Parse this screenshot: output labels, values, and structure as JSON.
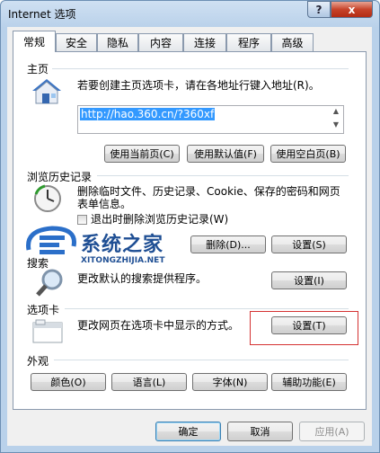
{
  "window": {
    "title": "Internet 选项",
    "help": "?",
    "close": "x"
  },
  "tabs": [
    {
      "label": "常规",
      "active": true
    },
    {
      "label": "安全"
    },
    {
      "label": "隐私"
    },
    {
      "label": "内容"
    },
    {
      "label": "连接"
    },
    {
      "label": "程序"
    },
    {
      "label": "高级"
    }
  ],
  "homepage": {
    "title": "主页",
    "desc": "若要创建主页选项卡，请在各地址行键入地址(R)。",
    "value": "http://hao.360.cn/?360xf",
    "use_current": "使用当前页(C)",
    "use_default": "使用默认值(F)",
    "use_blank": "使用空白页(B)"
  },
  "history": {
    "title": "浏览历史记录",
    "desc_line1": "删除临时文件、历史记录、Cookie、保存的密码和网页",
    "desc_line2": "表单信息。",
    "checkbox_label": "退出时删除浏览历史记录(W)",
    "delete": "删除(D)...",
    "settings": "设置(S)"
  },
  "search": {
    "title": "搜索",
    "desc": "更改默认的搜索提供程序。",
    "settings": "设置(I)"
  },
  "tabs_section": {
    "title": "选项卡",
    "desc": "更改网页在选项卡中显示的方式。",
    "settings": "设置(T)"
  },
  "appearance": {
    "title": "外观",
    "colors": "颜色(O)",
    "languages": "语言(L)",
    "fonts": "字体(N)",
    "accessibility": "辅助功能(E)"
  },
  "footer": {
    "ok": "确定",
    "cancel": "取消",
    "apply": "应用(A)"
  },
  "watermark": {
    "brand": "系统之家",
    "url": "XITONGZHIJIA.NET"
  },
  "colors": {
    "highlight": "#3399ff",
    "annotation_red": "#d43232",
    "separator": "#d5dfe5"
  }
}
